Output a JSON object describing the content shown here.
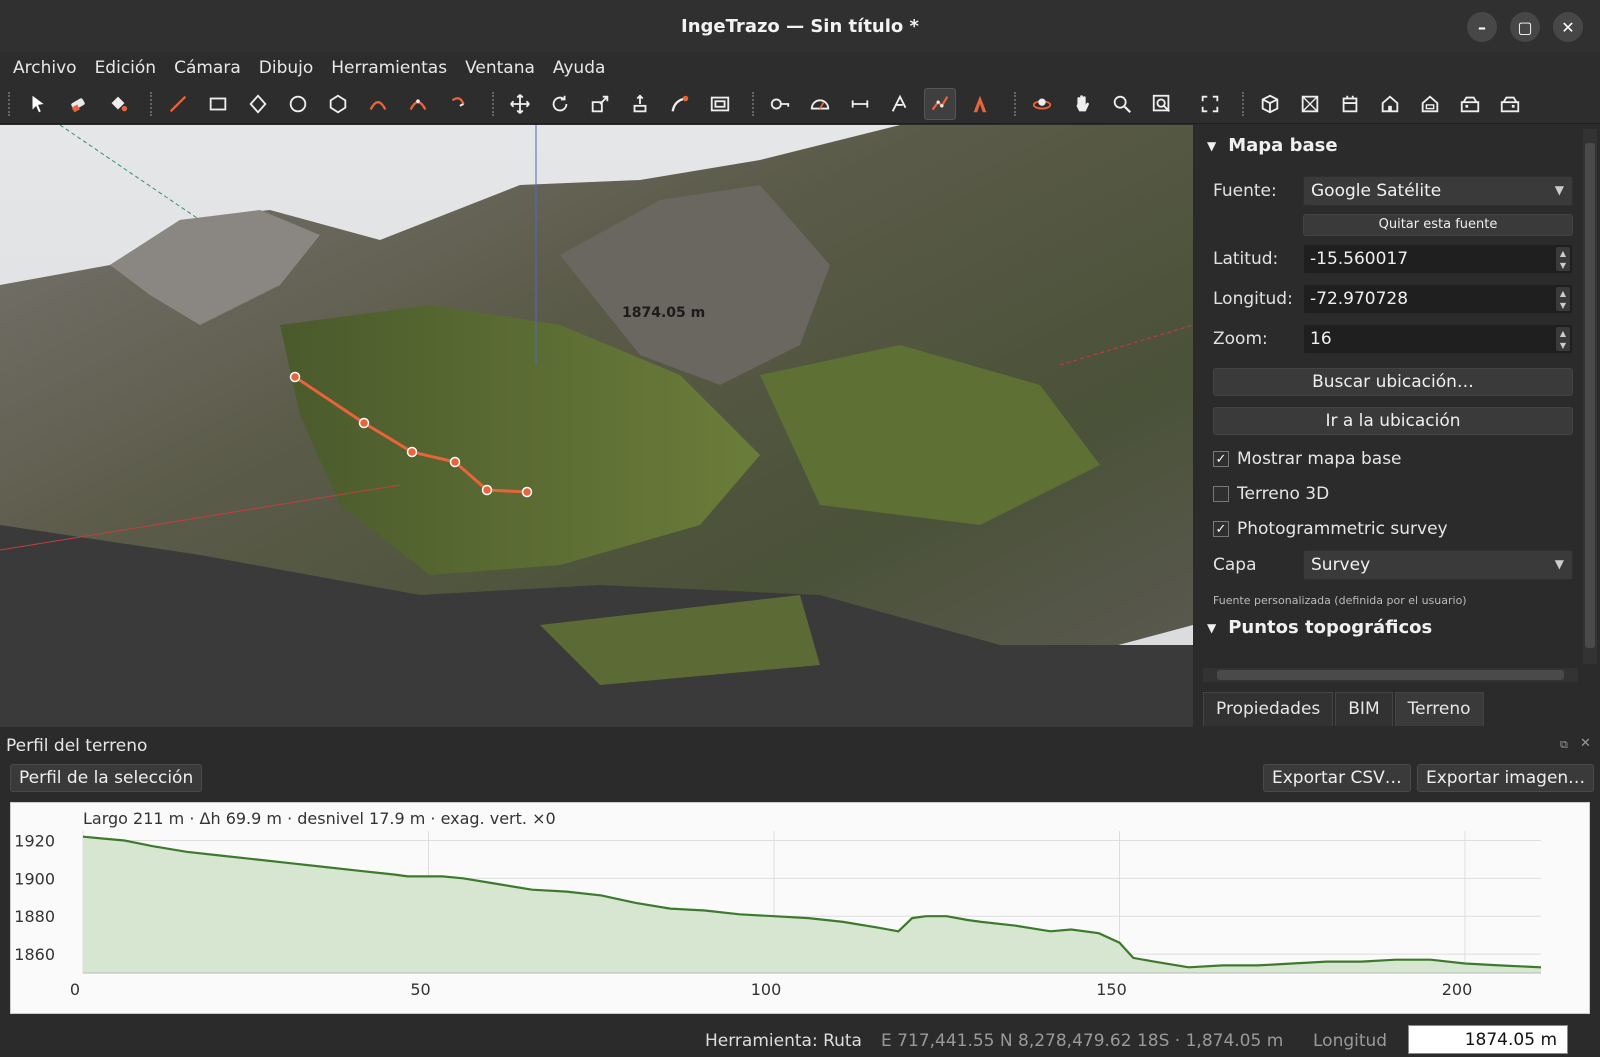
{
  "window": {
    "title": "IngeTrazo — Sin título *"
  },
  "menu": [
    "Archivo",
    "Edición",
    "Cámara",
    "Dibujo",
    "Herramientas",
    "Ventana",
    "Ayuda"
  ],
  "viewport": {
    "measure_label": "1874.05 m"
  },
  "panel": {
    "section_mapa": "Mapa base",
    "fuente_label": "Fuente:",
    "fuente_value": "Google Satélite",
    "quitar_btn": "Quitar esta fuente",
    "latitud_label": "Latitud:",
    "latitud_value": "-15.560017",
    "longitud_label": "Longitud:",
    "longitud_value": "-72.970728",
    "zoom_label": "Zoom:",
    "zoom_value": "16",
    "buscar_btn": "Buscar ubicación…",
    "ir_btn": "Ir a la ubicación",
    "mostrar_label": "Mostrar mapa base",
    "mostrar_checked": true,
    "terreno_label": "Terreno 3D",
    "terreno_checked": false,
    "photo_label": "Photogrammetric survey",
    "photo_checked": true,
    "capa_label": "Capa",
    "capa_value": "Survey",
    "hint": "Fuente personalizada (definida por el usuario)",
    "section_puntos": "Puntos topográficos"
  },
  "tabs": [
    "Propiedades",
    "BIM",
    "Terreno"
  ],
  "profile": {
    "title": "Perfil del terreno",
    "sel_btn": "Perfil de la selección",
    "csv_btn": "Exportar CSV…",
    "img_btn": "Exportar imagen…",
    "summary": "Largo 211 m · Δh 69.9 m · desnivel 17.9 m · exag. vert. ×0"
  },
  "chart_data": {
    "type": "area",
    "x": [
      0,
      3,
      6,
      10,
      15,
      20,
      25,
      30,
      35,
      40,
      45,
      47,
      52,
      55,
      60,
      65,
      70,
      75,
      80,
      85,
      90,
      95,
      100,
      105,
      110,
      115,
      118,
      120,
      122,
      125,
      128,
      130,
      135,
      140,
      143,
      147,
      150,
      152,
      155,
      160,
      165,
      170,
      175,
      180,
      185,
      190,
      195,
      200,
      205,
      211
    ],
    "values": [
      1922,
      1921,
      1920,
      1917,
      1914,
      1912,
      1910,
      1908,
      1906,
      1904,
      1902,
      1901,
      1901,
      1900,
      1897,
      1894,
      1893,
      1891,
      1887,
      1884,
      1883,
      1881,
      1880,
      1879,
      1877,
      1874,
      1872,
      1879,
      1880,
      1880,
      1878,
      1877,
      1875,
      1872,
      1873,
      1871,
      1866,
      1858,
      1856,
      1853,
      1854,
      1854,
      1855,
      1856,
      1856,
      1857,
      1857,
      1855,
      1854,
      1853
    ],
    "xlabel": "",
    "ylabel": "",
    "xlim": [
      0,
      211
    ],
    "ylim": [
      1850,
      1925
    ],
    "xticks": [
      0,
      50,
      100,
      150,
      200
    ],
    "yticks": [
      1860,
      1880,
      1900,
      1920
    ],
    "line_color": "#3e7a2e",
    "fill_color": "#d6e6d0",
    "grid": true
  },
  "status": {
    "tool": "Herramienta: Ruta",
    "coords": "E 717,441.55 N 8,278,479.62 18S · 1,874.05 m",
    "length_label": "Longitud",
    "length_value": "1874.05 m"
  }
}
